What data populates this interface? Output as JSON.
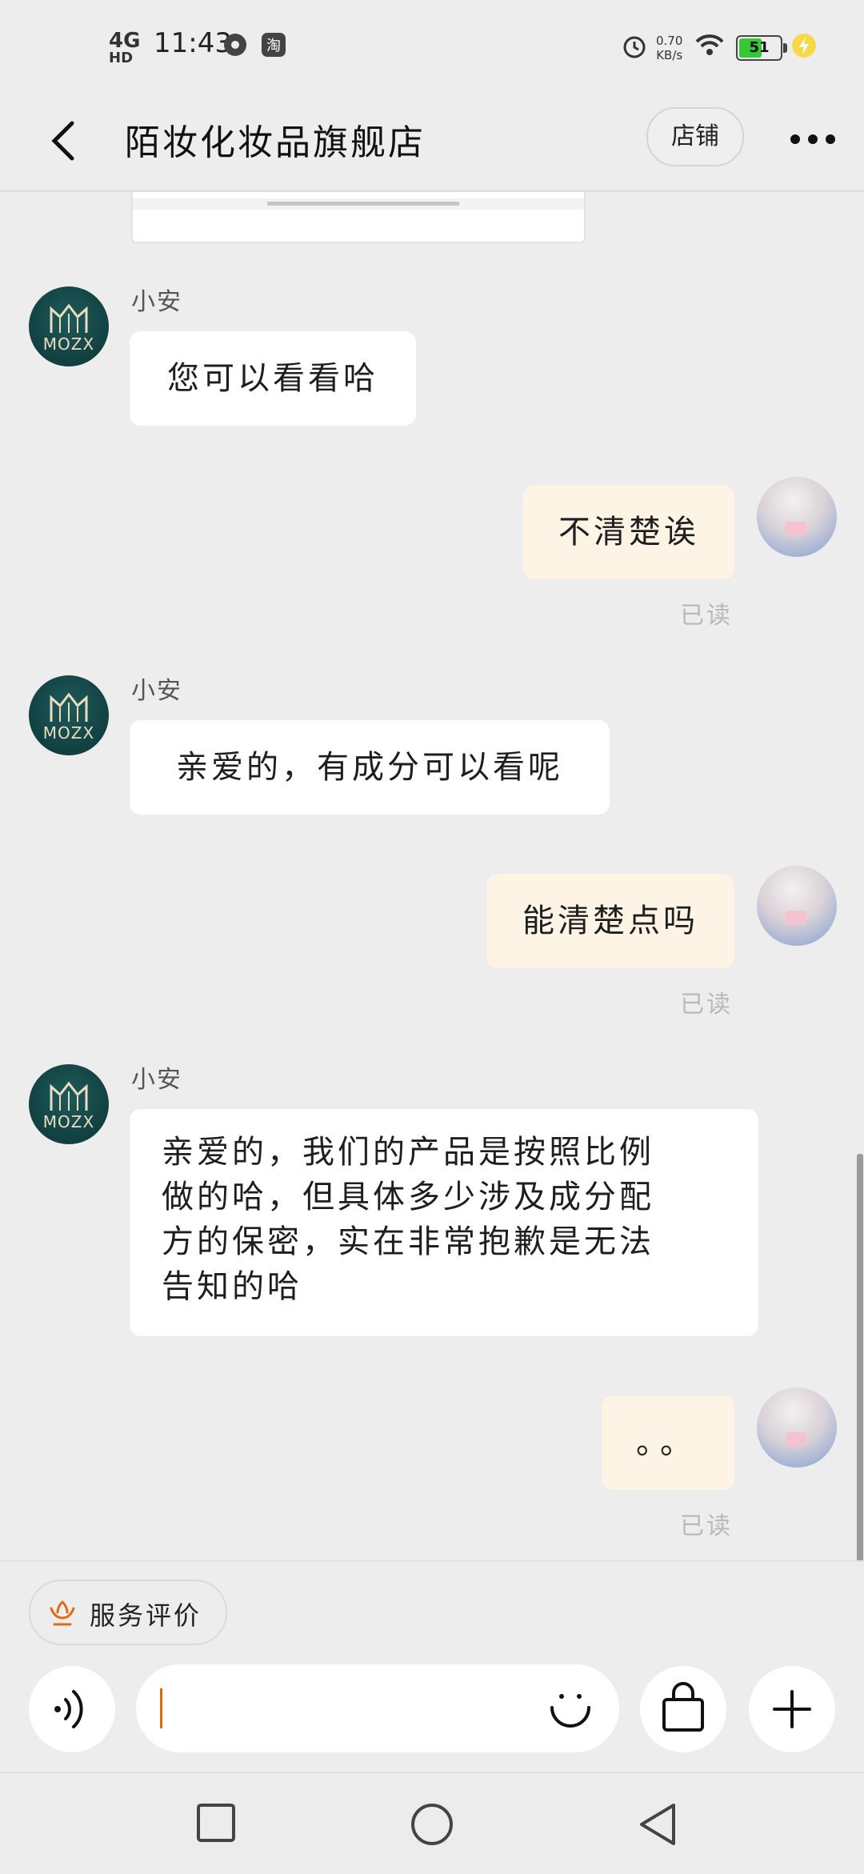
{
  "status_bar": {
    "network": "4G",
    "network_sub": "HD",
    "time": "11:43",
    "speed_value": "0.70",
    "speed_unit": "KB/s",
    "battery": "51"
  },
  "header": {
    "title": "陌妆化妆品旗舰店",
    "shop_label": "店铺"
  },
  "shop_avatar": {
    "brand": "MOZX"
  },
  "messages": [
    {
      "sender": "小安",
      "text": "您可以看看哈"
    },
    {
      "text": "不清楚诶",
      "status": "已读"
    },
    {
      "sender": "小安",
      "text": "亲爱的，有成分可以看呢"
    },
    {
      "text": "能清楚点吗",
      "status": "已读"
    },
    {
      "sender": "小安",
      "lines": [
        "亲爱的，我们的产品是按照比例",
        "做的哈，但具体多少涉及成分配",
        "方的保密，实在非常抱歉是无法",
        "告知的哈"
      ]
    },
    {
      "text": "。。",
      "status": "已读"
    }
  ],
  "composer": {
    "review_label": "服务评价",
    "input_value": "",
    "icons": [
      "voice-icon",
      "emoji-icon",
      "shopping-bag-icon",
      "plus-icon"
    ]
  },
  "colors": {
    "background": "#ededed",
    "incoming_bubble": "#ffffff",
    "outgoing_bubble": "#fdf4e6",
    "accent": "#e06a12",
    "shop_avatar": "#0d3536"
  },
  "navigation": [
    "recent-apps-icon",
    "home-icon",
    "back-icon"
  ]
}
